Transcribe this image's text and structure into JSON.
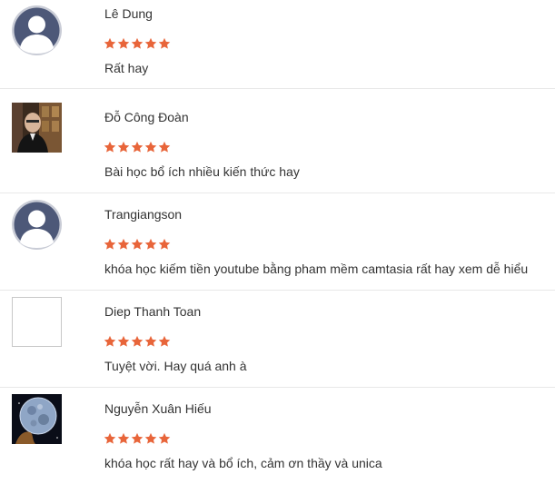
{
  "star_color": "#e8653a",
  "reviews": [
    {
      "name": "Lê Dung",
      "rating": 5,
      "comment": "Rất hay",
      "avatar": "default-user-icon"
    },
    {
      "name": "Đỗ Công Đoàn",
      "rating": 5,
      "comment": "Bài học bổ ích nhiều kiến thức hay",
      "avatar": "user-photo"
    },
    {
      "name": "Trangiangson",
      "rating": 5,
      "comment": "khóa học kiếm tiền youtube bằng pham mềm camtasia rất hay xem dễ hiểu",
      "avatar": "default-user-icon"
    },
    {
      "name": "Diep Thanh Toan",
      "rating": 5,
      "comment": "Tuyệt vời. Hay quá anh à",
      "avatar": "blank-avatar"
    },
    {
      "name": "Nguyễn Xuân Hiếu",
      "rating": 5,
      "comment": "khóa học rất hay và bổ ích, cảm ơn thầy và unica",
      "avatar": "moon-photo"
    }
  ]
}
